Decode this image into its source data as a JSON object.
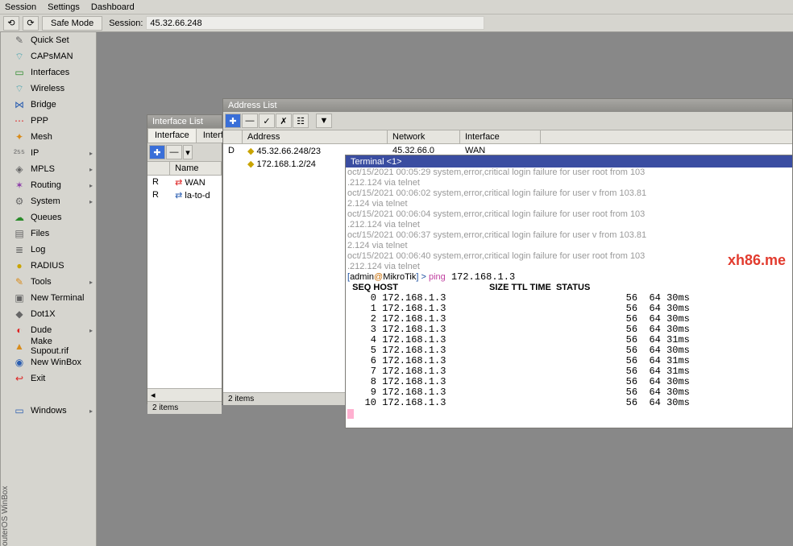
{
  "menu": {
    "items": [
      "Session",
      "Settings",
      "Dashboard"
    ]
  },
  "toolbar": {
    "back_icon": "⟲",
    "fwd_icon": "⟳",
    "safe_mode": "Safe Mode",
    "session_label": "Session:",
    "session_value": "45.32.66.248"
  },
  "vtitle": "outerOS WinBox",
  "sidebar": {
    "items": [
      {
        "icon": "✎",
        "cls": "ic-gray",
        "label": "Quick Set",
        "arrow": false
      },
      {
        "icon": "⌔",
        "cls": "ic-teal",
        "label": "CAPsMAN",
        "arrow": false
      },
      {
        "icon": "▭",
        "cls": "ic-green",
        "label": "Interfaces",
        "arrow": false
      },
      {
        "icon": "⌔",
        "cls": "ic-teal",
        "label": "Wireless",
        "arrow": false
      },
      {
        "icon": "⋈",
        "cls": "ic-blue",
        "label": "Bridge",
        "arrow": false
      },
      {
        "icon": "⋯",
        "cls": "ic-red",
        "label": "PPP",
        "arrow": false
      },
      {
        "icon": "✦",
        "cls": "ic-orange",
        "label": "Mesh",
        "arrow": false
      },
      {
        "icon": "²⁵⁵",
        "cls": "ic-gray",
        "label": "IP",
        "arrow": true
      },
      {
        "icon": "◈",
        "cls": "ic-gray",
        "label": "MPLS",
        "arrow": true
      },
      {
        "icon": "✶",
        "cls": "ic-purple",
        "label": "Routing",
        "arrow": true
      },
      {
        "icon": "⚙",
        "cls": "ic-gray",
        "label": "System",
        "arrow": true
      },
      {
        "icon": "☁",
        "cls": "ic-green",
        "label": "Queues",
        "arrow": false
      },
      {
        "icon": "▤",
        "cls": "ic-gray",
        "label": "Files",
        "arrow": false
      },
      {
        "icon": "≣",
        "cls": "ic-gray",
        "label": "Log",
        "arrow": false
      },
      {
        "icon": "●",
        "cls": "ic-gold",
        "label": "RADIUS",
        "arrow": false
      },
      {
        "icon": "✎",
        "cls": "ic-orange",
        "label": "Tools",
        "arrow": true
      },
      {
        "icon": "▣",
        "cls": "ic-gray",
        "label": "New Terminal",
        "arrow": false
      },
      {
        "icon": "◆",
        "cls": "ic-gray",
        "label": "Dot1X",
        "arrow": false
      },
      {
        "icon": "◐",
        "cls": "ic-red",
        "label": "Dude",
        "arrow": true
      },
      {
        "icon": "▲",
        "cls": "ic-orange",
        "label": "Make Supout.rif",
        "arrow": false
      },
      {
        "icon": "◉",
        "cls": "ic-blue",
        "label": "New WinBox",
        "arrow": false
      },
      {
        "icon": "↩",
        "cls": "ic-red",
        "label": "Exit",
        "arrow": false
      },
      {
        "icon": "",
        "cls": "",
        "label": "",
        "arrow": false
      },
      {
        "icon": "▭",
        "cls": "ic-blue",
        "label": "Windows",
        "arrow": true
      }
    ]
  },
  "interface_list": {
    "title": "Interface List",
    "tabs": [
      "Interface",
      "Interfa"
    ],
    "tools": {
      "add": "✚",
      "del": "—",
      "arrow": "▾"
    },
    "head": [
      "",
      "Name"
    ],
    "rows": [
      {
        "flag": "R",
        "ico": "⇄",
        "ico_cls": "ic-red",
        "name": "WAN"
      },
      {
        "flag": "R",
        "ico": "⇄",
        "ico_cls": "ic-blue",
        "name": "la-to-d"
      }
    ],
    "scroll_l": "◂",
    "status": "2 items"
  },
  "address_list": {
    "title": "Address List",
    "tools": {
      "add": "✚",
      "del": "—",
      "enable": "✓",
      "disable": "✗",
      "comment": "☷",
      "filter": "▼"
    },
    "head": [
      "",
      "Address",
      "Network",
      "Interface"
    ],
    "rows": [
      {
        "flag": "D",
        "ico": "◆",
        "ico_cls": "ic-gold",
        "addr": "45.32.66.248/23",
        "net": "45.32.66.0",
        "iface": "WAN"
      },
      {
        "flag": "",
        "ico": "◆",
        "ico_cls": "ic-gold",
        "addr": "172.168.1.2/24",
        "net": "",
        "iface": ""
      }
    ],
    "status": "2 items"
  },
  "terminal": {
    "title": "Terminal <1>",
    "log": [
      "oct/15/2021 00:05:29 system,error,critical login failure for user root from 103",
      ".212.124 via telnet",
      "oct/15/2021 00:06:02 system,error,critical login failure for user v from 103.81",
      "2.124 via telnet",
      "oct/15/2021 00:06:04 system,error,critical login failure for user root from 103",
      ".212.124 via telnet",
      "oct/15/2021 00:06:37 system,error,critical login failure for user v from 103.81",
      "2.124 via telnet",
      "oct/15/2021 00:06:40 system,error,critical login failure for user root from 103",
      ".212.124 via telnet"
    ],
    "prompt": {
      "open": "[",
      "user": "admin",
      "at": "@",
      "host": "MikroTik",
      "close": "] > ",
      "cmd": "ping",
      "args": " 172.168.1.3"
    },
    "ping_head": "  SEQ HOST                                     SIZE TTL TIME  STATUS",
    "ping_rows": [
      {
        "seq": "    0",
        "host": " 172.168.1.3                               ",
        "size": "56",
        "ttl": "  64",
        "time": " 30ms"
      },
      {
        "seq": "    1",
        "host": " 172.168.1.3                               ",
        "size": "56",
        "ttl": "  64",
        "time": " 30ms"
      },
      {
        "seq": "    2",
        "host": " 172.168.1.3                               ",
        "size": "56",
        "ttl": "  64",
        "time": " 30ms"
      },
      {
        "seq": "    3",
        "host": " 172.168.1.3                               ",
        "size": "56",
        "ttl": "  64",
        "time": " 30ms"
      },
      {
        "seq": "    4",
        "host": " 172.168.1.3                               ",
        "size": "56",
        "ttl": "  64",
        "time": " 31ms"
      },
      {
        "seq": "    5",
        "host": " 172.168.1.3                               ",
        "size": "56",
        "ttl": "  64",
        "time": " 30ms"
      },
      {
        "seq": "    6",
        "host": " 172.168.1.3                               ",
        "size": "56",
        "ttl": "  64",
        "time": " 31ms"
      },
      {
        "seq": "    7",
        "host": " 172.168.1.3                               ",
        "size": "56",
        "ttl": "  64",
        "time": " 31ms"
      },
      {
        "seq": "    8",
        "host": " 172.168.1.3                               ",
        "size": "56",
        "ttl": "  64",
        "time": " 30ms"
      },
      {
        "seq": "    9",
        "host": " 172.168.1.3                               ",
        "size": "56",
        "ttl": "  64",
        "time": " 30ms"
      },
      {
        "seq": "   10",
        "host": " 172.168.1.3                               ",
        "size": "56",
        "ttl": "  64",
        "time": " 30ms"
      }
    ]
  },
  "watermark": "xh86.me"
}
